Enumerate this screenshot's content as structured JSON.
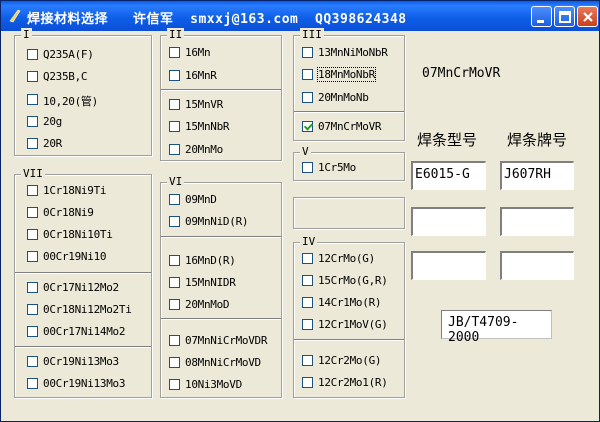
{
  "window": {
    "title": "焊接材料选择   许信军  smxxj@163.com  QQ398624348"
  },
  "groups": [
    {
      "id": "I",
      "label": "I",
      "items": [
        {
          "label": "Q235A(F)",
          "checked": false
        },
        {
          "label": "Q235B,C",
          "checked": false
        },
        {
          "label": "10,20(管)",
          "checked": false
        },
        {
          "label": "20g",
          "checked": false
        },
        {
          "label": "20R",
          "checked": false
        }
      ]
    },
    {
      "id": "II",
      "label": "II",
      "items": [
        {
          "label": "16Mn",
          "checked": false
        },
        {
          "label": "16MnR",
          "checked": false
        },
        {
          "label": "15MnVR",
          "checked": false
        },
        {
          "label": "15MnNbR",
          "checked": false
        },
        {
          "label": "20MnMo",
          "checked": false
        }
      ]
    },
    {
      "id": "III",
      "label": "III",
      "items": [
        {
          "label": "13MnNiMoNbR",
          "checked": false
        },
        {
          "label": "18MnMoNbR",
          "checked": false,
          "focus": true
        },
        {
          "label": "20MnMoNb",
          "checked": false
        },
        {
          "label": "07MnCrMoVR",
          "checked": true
        }
      ]
    },
    {
      "id": "V",
      "label": "V",
      "items": [
        {
          "label": "1Cr5Mo",
          "checked": false
        }
      ]
    },
    {
      "id": "VI",
      "label": "VI",
      "items": [
        {
          "label": "09MnD",
          "checked": false
        },
        {
          "label": "09MnNiD(R)",
          "checked": false
        },
        {
          "label": "16MnD(R)",
          "checked": false
        },
        {
          "label": "15MnNIDR",
          "checked": false
        },
        {
          "label": "20MnMoD",
          "checked": false
        },
        {
          "label": "07MnNiCrMoVDR",
          "checked": false
        },
        {
          "label": "08MnNiCrMoVD",
          "checked": false
        },
        {
          "label": "10Ni3MoVD",
          "checked": false
        }
      ]
    },
    {
      "id": "IV",
      "label": "IV",
      "items": [
        {
          "label": "12CrMo(G)",
          "checked": false
        },
        {
          "label": "15CrMo(G,R)",
          "checked": false
        },
        {
          "label": "14Cr1Mo(R)",
          "checked": false
        },
        {
          "label": "12Cr1MoV(G)",
          "checked": false
        },
        {
          "label": "12Cr2Mo(G)",
          "checked": false
        },
        {
          "label": "12Cr2Mo1(R)",
          "checked": false
        }
      ]
    },
    {
      "id": "VII",
      "label": "VII",
      "items": [
        {
          "label": "1Cr18Ni9Ti",
          "checked": false
        },
        {
          "label": "0Cr18Ni9",
          "checked": false
        },
        {
          "label": "0Cr18Ni10Ti",
          "checked": false
        },
        {
          "label": "00Cr19Ni10",
          "checked": false
        },
        {
          "label": "0Cr17Ni12Mo2",
          "checked": false
        },
        {
          "label": "0Cr18Ni12Mo2Ti",
          "checked": false
        },
        {
          "label": "00Cr17Ni14Mo2",
          "checked": false
        },
        {
          "label": "0Cr19Ni13Mo3",
          "checked": false
        },
        {
          "label": "00Cr19Ni13Mo3",
          "checked": false
        }
      ]
    }
  ],
  "selected_material": "07MnCrMoVR",
  "headers": {
    "model": "焊条型号",
    "brand": "焊条牌号"
  },
  "results": [
    {
      "model": "E6015-G",
      "brand": "J607RH"
    },
    {
      "model": "",
      "brand": ""
    },
    {
      "model": "",
      "brand": ""
    }
  ],
  "standard": "JB/T4709-2000"
}
